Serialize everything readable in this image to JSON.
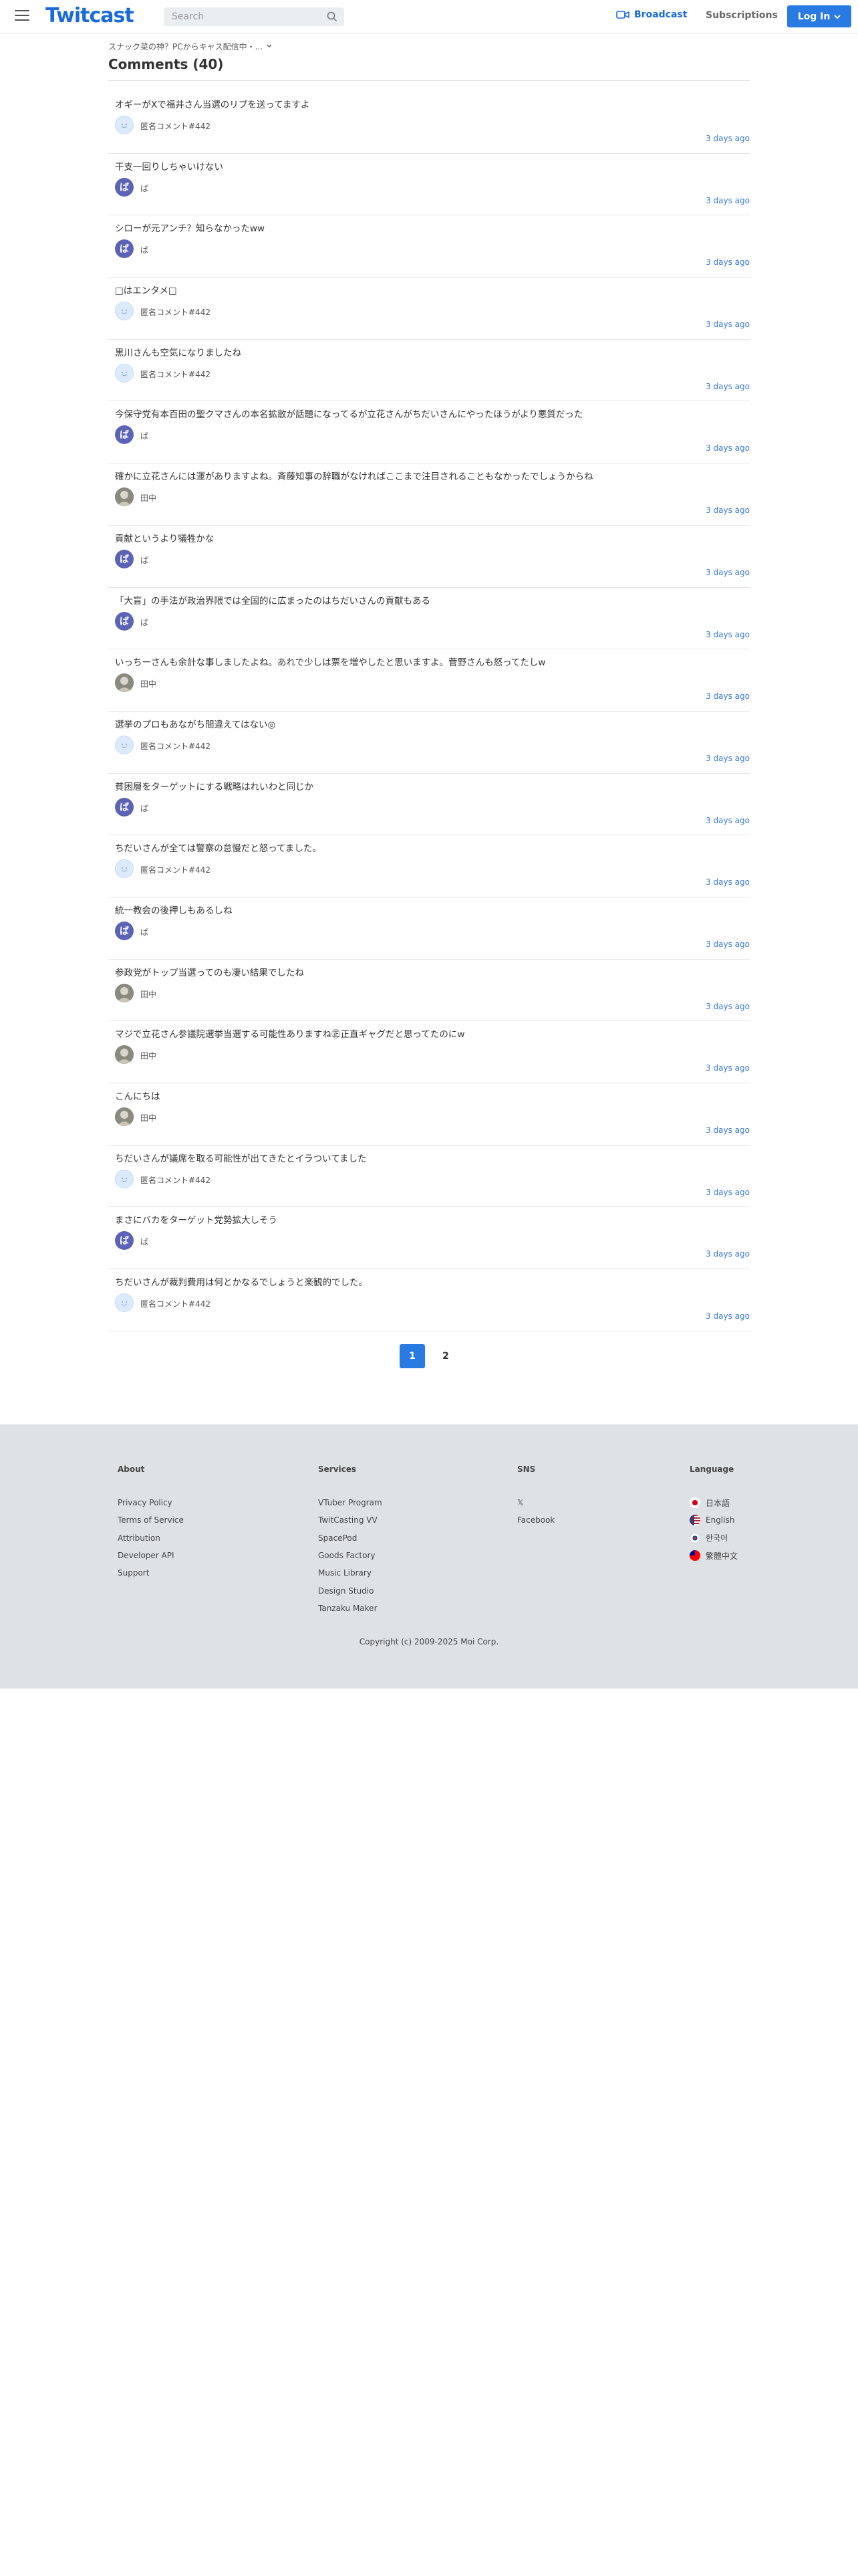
{
  "header": {
    "logo": "Twitcast",
    "search_placeholder": "Search",
    "broadcast": "Broadcast",
    "subscriptions": "Subscriptions",
    "login": "Log In"
  },
  "breadcrumb": "スナック菜の神？PCからキャス配信中・...",
  "page_title": "Comments (40)",
  "comments": [
    {
      "text": "オギーがXで福井さん当選のリプを送ってますよ",
      "user": "匿名コメント#442",
      "avatar": "anon",
      "time": "3 days ago"
    },
    {
      "text": "干支一回りしちゃいけない",
      "user": "ば",
      "avatar": "ba",
      "time": "3 days ago"
    },
    {
      "text": "シローが元アンチ？知らなかったww",
      "user": "ば",
      "avatar": "ba",
      "time": "3 days ago"
    },
    {
      "text": "□はエンタメ□",
      "user": "匿名コメント#442",
      "avatar": "anon",
      "time": "3 days ago"
    },
    {
      "text": "黒川さんも空気になりましたね",
      "user": "匿名コメント#442",
      "avatar": "anon",
      "time": "3 days ago"
    },
    {
      "text": "今保守党有本百田の聖クマさんの本名拡散が話題になってるが立花さんがちだいさんにやったほうがより悪質だった",
      "user": "ば",
      "avatar": "ba",
      "time": "3 days ago"
    },
    {
      "text": "確かに立花さんには運がありますよね。斉藤知事の辞職がなければここまで注目されることもなかったでしょうからね",
      "user": "田中",
      "avatar": "tanaka",
      "time": "3 days ago"
    },
    {
      "text": "貢献というより犠牲かな",
      "user": "ば",
      "avatar": "ba",
      "time": "3 days ago"
    },
    {
      "text": "「大盲」の手法が政治界隈では全国的に広まったのはちだいさんの貢献もある",
      "user": "ば",
      "avatar": "ba",
      "time": "3 days ago"
    },
    {
      "text": "いっちーさんも余計な事しましたよね。あれで少しは票を増やしたと思いますよ。菅野さんも怒ってたしw",
      "user": "田中",
      "avatar": "tanaka",
      "time": "3 days ago"
    },
    {
      "text": "選挙のプロもあながち間違えてはない◎",
      "user": "匿名コメント#442",
      "avatar": "anon",
      "time": "3 days ago"
    },
    {
      "text": "貧困層をターゲットにする戦略はれいわと同じか",
      "user": "ば",
      "avatar": "ba",
      "time": "3 days ago"
    },
    {
      "text": "ちだいさんが全ては警察の怠慢だと怒ってました。",
      "user": "匿名コメント#442",
      "avatar": "anon",
      "time": "3 days ago"
    },
    {
      "text": "統一教会の後押しもあるしね",
      "user": "ば",
      "avatar": "ba",
      "time": "3 days ago"
    },
    {
      "text": "参政党がトップ当選ってのも凄い結果でしたね",
      "user": "田中",
      "avatar": "tanaka",
      "time": "3 days ago"
    },
    {
      "text": "マジで立花さん参議院選挙当選する可能性ありますね㊣正直ギャグだと思ってたのにw",
      "user": "田中",
      "avatar": "tanaka",
      "time": "3 days ago"
    },
    {
      "text": "こんにちは",
      "user": "田中",
      "avatar": "tanaka",
      "time": "3 days ago"
    },
    {
      "text": "ちだいさんが議席を取る可能性が出てきたとイラついてました",
      "user": "匿名コメント#442",
      "avatar": "anon",
      "time": "3 days ago"
    },
    {
      "text": "まさにバカをターゲット党勢拡大しそう",
      "user": "ば",
      "avatar": "ba",
      "time": "3 days ago"
    },
    {
      "text": "ちだいさんが裁判費用は何とかなるでしょうと楽観的でした。",
      "user": "匿名コメント#442",
      "avatar": "anon",
      "time": "3 days ago"
    }
  ],
  "pagination": [
    "1",
    "2"
  ],
  "footer": {
    "about": {
      "title": "About",
      "links": [
        "Privacy Policy",
        "Terms of Service",
        "Attribution",
        "Developer API",
        "Support"
      ]
    },
    "services": {
      "title": "Services",
      "links": [
        "VTuber Program",
        "TwitCasting VV",
        "SpacePod",
        "Goods Factory",
        "Music Library",
        "Design Studio",
        "Tanzaku Maker"
      ]
    },
    "sns": {
      "title": "SNS",
      "links": [
        "𝕏",
        "Facebook"
      ]
    },
    "language": {
      "title": "Language",
      "links": [
        "日本語",
        "English",
        "한국어",
        "繁體中文"
      ]
    },
    "copyright": "Copyright (c) 2009-2025 Moi Corp."
  },
  "colors": {
    "brand": "#1a6bd8",
    "button": "#2a7ae4",
    "link": "#3a7bd5",
    "footer_bg": "#dfe2e5"
  }
}
